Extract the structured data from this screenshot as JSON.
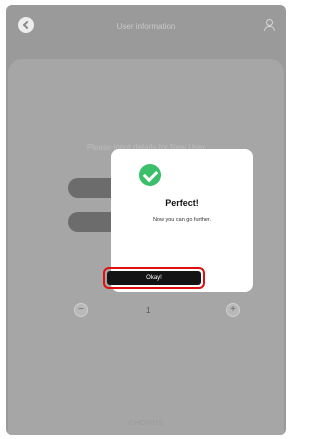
{
  "header": {
    "title": "User information",
    "back_icon": "back-arrow-icon",
    "user_icon": "user-icon"
  },
  "form": {
    "prompt": "Please input details for New User",
    "stepper": {
      "minus": "−",
      "plus": "+",
      "value": "1"
    },
    "footer": "CHOWDS"
  },
  "modal": {
    "icon": "checkmark-circle-icon",
    "title": "Perfect!",
    "message": "Now you can go further.",
    "button_label": "Okay!"
  },
  "colors": {
    "success": "#3bbf6a",
    "button": "#141414",
    "highlight": "#e01010",
    "overlay": "#9a9a9a"
  }
}
